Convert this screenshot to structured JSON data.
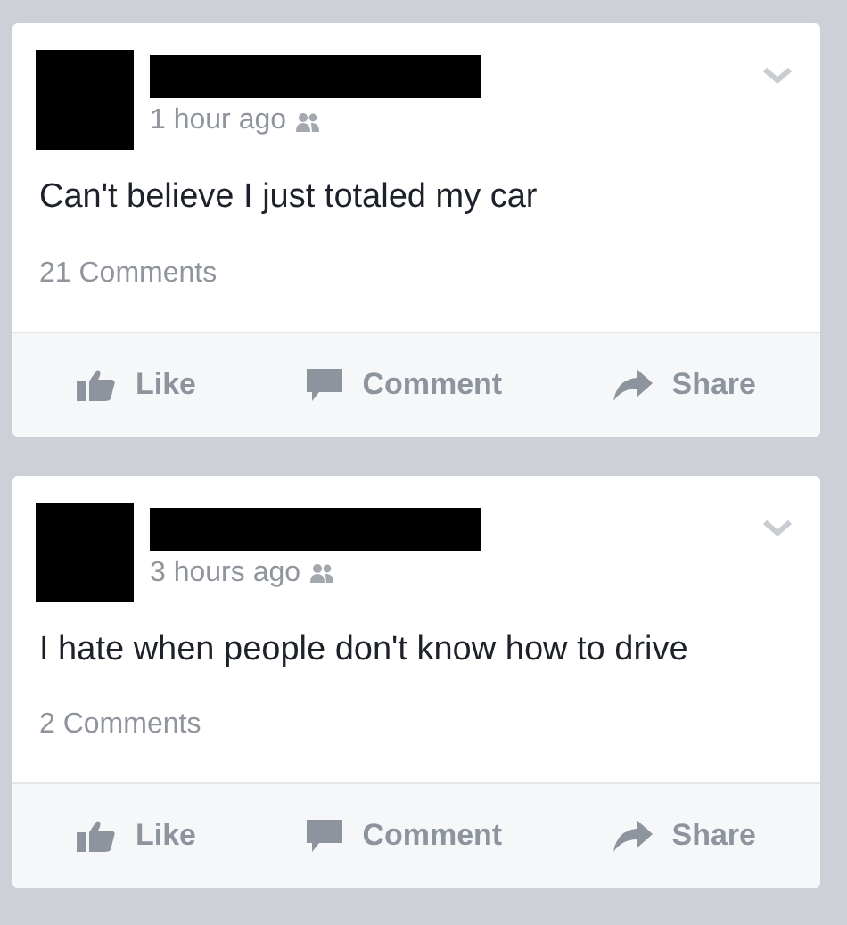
{
  "posts": [
    {
      "time": "1 hour ago",
      "text": "Can't believe I just totaled my car",
      "comments": "21 Comments",
      "actions": [
        {
          "kind": "like",
          "label": "Like"
        },
        {
          "kind": "comment",
          "label": "Comment"
        },
        {
          "kind": "share",
          "label": "Share"
        }
      ]
    },
    {
      "time": "3 hours ago",
      "text": "I hate when people don't know how to drive",
      "comments": "2 Comments",
      "actions": [
        {
          "kind": "like",
          "label": "Like"
        },
        {
          "kind": "comment",
          "label": "Comment"
        },
        {
          "kind": "share",
          "label": "Share"
        }
      ]
    }
  ]
}
